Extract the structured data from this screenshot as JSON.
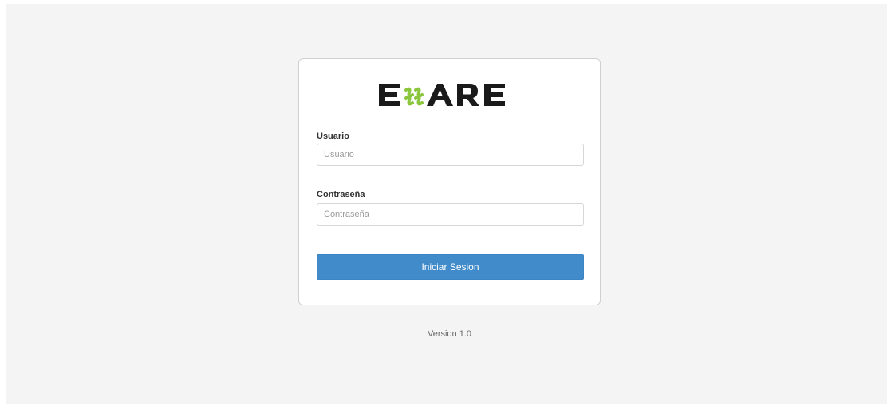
{
  "login": {
    "logo_text": "ESSARE",
    "logo_colors": {
      "letters": "#1a1a1a",
      "accent": "#8cc63f"
    },
    "username_label": "Usuario",
    "username_placeholder": "Usuario",
    "username_value": "",
    "password_label": "Contraseña",
    "password_placeholder": "Contraseña",
    "password_value": "",
    "submit_label": "Iniciar Sesion",
    "button_color": "#428bca"
  },
  "footer": {
    "version": "Version 1.0"
  }
}
